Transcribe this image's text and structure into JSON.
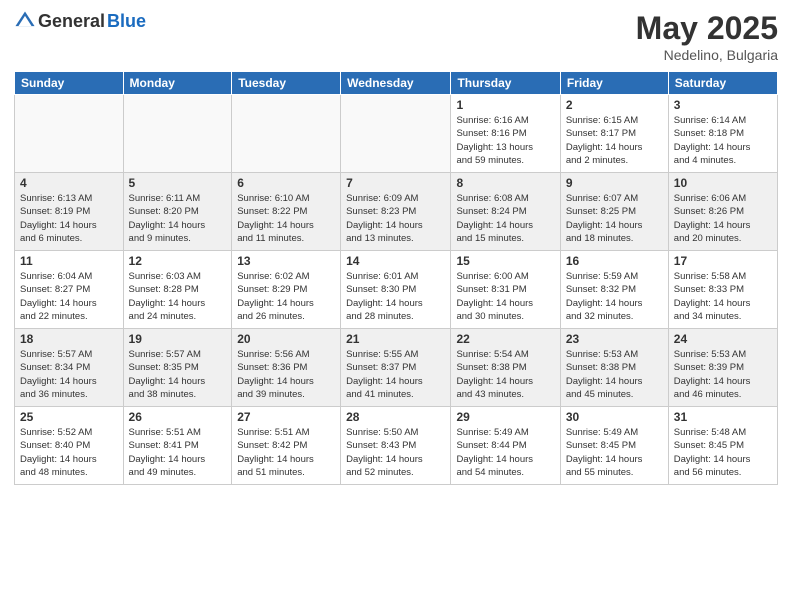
{
  "header": {
    "logo_general": "General",
    "logo_blue": "Blue",
    "month_title": "May 2025",
    "location": "Nedelino, Bulgaria"
  },
  "days_of_week": [
    "Sunday",
    "Monday",
    "Tuesday",
    "Wednesday",
    "Thursday",
    "Friday",
    "Saturday"
  ],
  "weeks": [
    [
      {
        "day": "",
        "info": "",
        "empty": true
      },
      {
        "day": "",
        "info": "",
        "empty": true
      },
      {
        "day": "",
        "info": "",
        "empty": true
      },
      {
        "day": "",
        "info": "",
        "empty": true
      },
      {
        "day": "1",
        "info": "Sunrise: 6:16 AM\nSunset: 8:16 PM\nDaylight: 13 hours\nand 59 minutes."
      },
      {
        "day": "2",
        "info": "Sunrise: 6:15 AM\nSunset: 8:17 PM\nDaylight: 14 hours\nand 2 minutes."
      },
      {
        "day": "3",
        "info": "Sunrise: 6:14 AM\nSunset: 8:18 PM\nDaylight: 14 hours\nand 4 minutes."
      }
    ],
    [
      {
        "day": "4",
        "info": "Sunrise: 6:13 AM\nSunset: 8:19 PM\nDaylight: 14 hours\nand 6 minutes.",
        "shaded": true
      },
      {
        "day": "5",
        "info": "Sunrise: 6:11 AM\nSunset: 8:20 PM\nDaylight: 14 hours\nand 9 minutes.",
        "shaded": true
      },
      {
        "day": "6",
        "info": "Sunrise: 6:10 AM\nSunset: 8:22 PM\nDaylight: 14 hours\nand 11 minutes.",
        "shaded": true
      },
      {
        "day": "7",
        "info": "Sunrise: 6:09 AM\nSunset: 8:23 PM\nDaylight: 14 hours\nand 13 minutes.",
        "shaded": true
      },
      {
        "day": "8",
        "info": "Sunrise: 6:08 AM\nSunset: 8:24 PM\nDaylight: 14 hours\nand 15 minutes.",
        "shaded": true
      },
      {
        "day": "9",
        "info": "Sunrise: 6:07 AM\nSunset: 8:25 PM\nDaylight: 14 hours\nand 18 minutes.",
        "shaded": true
      },
      {
        "day": "10",
        "info": "Sunrise: 6:06 AM\nSunset: 8:26 PM\nDaylight: 14 hours\nand 20 minutes.",
        "shaded": true
      }
    ],
    [
      {
        "day": "11",
        "info": "Sunrise: 6:04 AM\nSunset: 8:27 PM\nDaylight: 14 hours\nand 22 minutes."
      },
      {
        "day": "12",
        "info": "Sunrise: 6:03 AM\nSunset: 8:28 PM\nDaylight: 14 hours\nand 24 minutes."
      },
      {
        "day": "13",
        "info": "Sunrise: 6:02 AM\nSunset: 8:29 PM\nDaylight: 14 hours\nand 26 minutes."
      },
      {
        "day": "14",
        "info": "Sunrise: 6:01 AM\nSunset: 8:30 PM\nDaylight: 14 hours\nand 28 minutes."
      },
      {
        "day": "15",
        "info": "Sunrise: 6:00 AM\nSunset: 8:31 PM\nDaylight: 14 hours\nand 30 minutes."
      },
      {
        "day": "16",
        "info": "Sunrise: 5:59 AM\nSunset: 8:32 PM\nDaylight: 14 hours\nand 32 minutes."
      },
      {
        "day": "17",
        "info": "Sunrise: 5:58 AM\nSunset: 8:33 PM\nDaylight: 14 hours\nand 34 minutes."
      }
    ],
    [
      {
        "day": "18",
        "info": "Sunrise: 5:57 AM\nSunset: 8:34 PM\nDaylight: 14 hours\nand 36 minutes.",
        "shaded": true
      },
      {
        "day": "19",
        "info": "Sunrise: 5:57 AM\nSunset: 8:35 PM\nDaylight: 14 hours\nand 38 minutes.",
        "shaded": true
      },
      {
        "day": "20",
        "info": "Sunrise: 5:56 AM\nSunset: 8:36 PM\nDaylight: 14 hours\nand 39 minutes.",
        "shaded": true
      },
      {
        "day": "21",
        "info": "Sunrise: 5:55 AM\nSunset: 8:37 PM\nDaylight: 14 hours\nand 41 minutes.",
        "shaded": true
      },
      {
        "day": "22",
        "info": "Sunrise: 5:54 AM\nSunset: 8:38 PM\nDaylight: 14 hours\nand 43 minutes.",
        "shaded": true
      },
      {
        "day": "23",
        "info": "Sunrise: 5:53 AM\nSunset: 8:38 PM\nDaylight: 14 hours\nand 45 minutes.",
        "shaded": true
      },
      {
        "day": "24",
        "info": "Sunrise: 5:53 AM\nSunset: 8:39 PM\nDaylight: 14 hours\nand 46 minutes.",
        "shaded": true
      }
    ],
    [
      {
        "day": "25",
        "info": "Sunrise: 5:52 AM\nSunset: 8:40 PM\nDaylight: 14 hours\nand 48 minutes."
      },
      {
        "day": "26",
        "info": "Sunrise: 5:51 AM\nSunset: 8:41 PM\nDaylight: 14 hours\nand 49 minutes."
      },
      {
        "day": "27",
        "info": "Sunrise: 5:51 AM\nSunset: 8:42 PM\nDaylight: 14 hours\nand 51 minutes."
      },
      {
        "day": "28",
        "info": "Sunrise: 5:50 AM\nSunset: 8:43 PM\nDaylight: 14 hours\nand 52 minutes."
      },
      {
        "day": "29",
        "info": "Sunrise: 5:49 AM\nSunset: 8:44 PM\nDaylight: 14 hours\nand 54 minutes."
      },
      {
        "day": "30",
        "info": "Sunrise: 5:49 AM\nSunset: 8:45 PM\nDaylight: 14 hours\nand 55 minutes."
      },
      {
        "day": "31",
        "info": "Sunrise: 5:48 AM\nSunset: 8:45 PM\nDaylight: 14 hours\nand 56 minutes."
      }
    ]
  ]
}
